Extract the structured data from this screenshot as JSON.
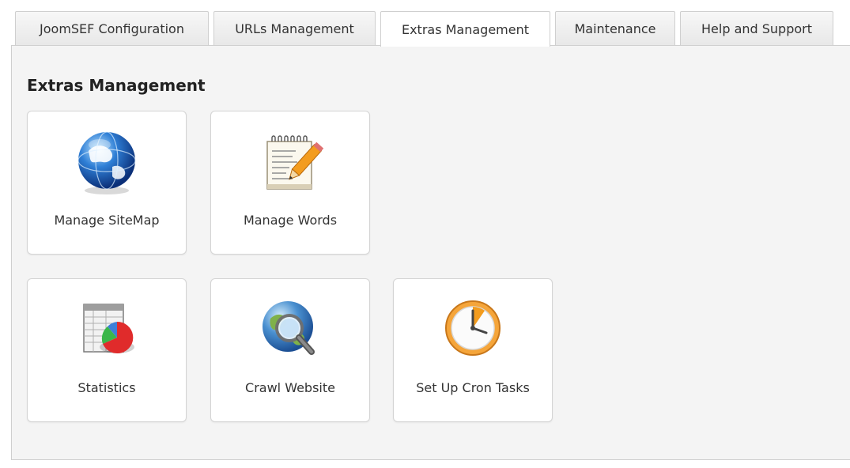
{
  "tabs": [
    {
      "label": "JoomSEF Configuration"
    },
    {
      "label": "URLs Management"
    },
    {
      "label": "Extras Management"
    },
    {
      "label": "Maintenance"
    },
    {
      "label": "Help and Support"
    }
  ],
  "active_tab": "Extras Management",
  "page": {
    "title": "Extras Management"
  },
  "tiles": [
    {
      "label": "Manage SiteMap",
      "icon": "globe-icon"
    },
    {
      "label": "Manage Words",
      "icon": "notepad-pencil-icon"
    },
    {
      "label": "Statistics",
      "icon": "spreadsheet-pie-chart-icon"
    },
    {
      "label": "Crawl Website",
      "icon": "globe-magnifier-icon"
    },
    {
      "label": "Set Up Cron Tasks",
      "icon": "clock-icon"
    }
  ],
  "colors": {
    "panel_bg": "#f4f4f4",
    "border": "#cfcfcf",
    "text": "#333333"
  }
}
